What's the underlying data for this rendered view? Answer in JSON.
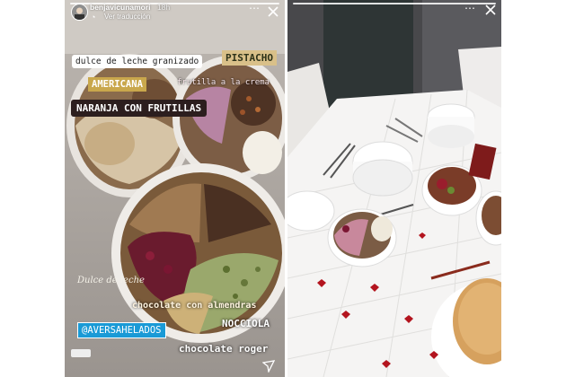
{
  "story1": {
    "username": "benjavicunamori",
    "time": "18h",
    "translation": "Ver traducción",
    "labels": {
      "dulce_granizado": "dulce de leche granizado",
      "pistacho": "PISTACHO",
      "americana": "AMERICANA",
      "frutilla": "frutilla a la crema",
      "naranja": "NARANJA CON FRUTILLAS",
      "dulce_leche": "Dulce de leche",
      "chocolate_almendras": "chocolate con almendras",
      "mention": "@AVERSAHELADOS",
      "nocciola": "NOCCIOLA",
      "chocolate_roger": "chocolate roger"
    }
  },
  "story2": {}
}
